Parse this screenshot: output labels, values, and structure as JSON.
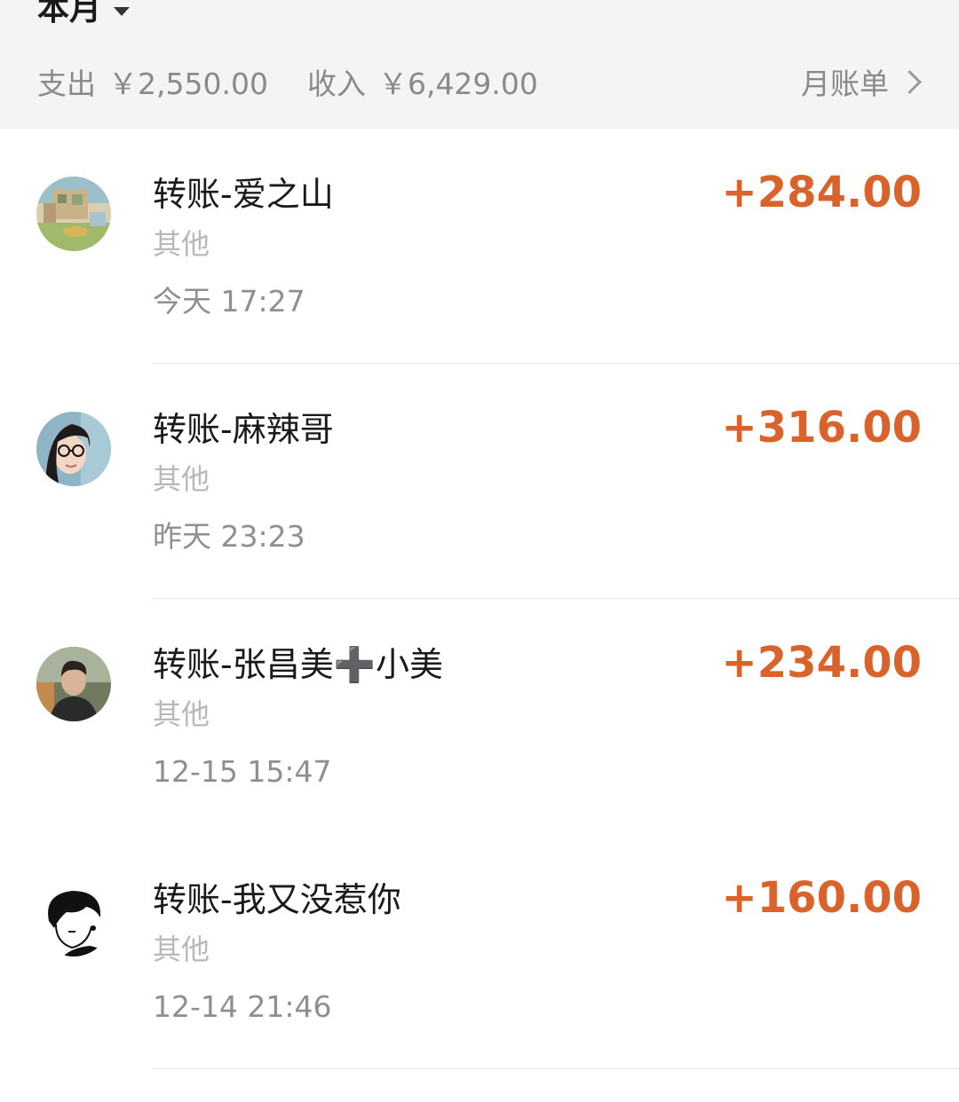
{
  "header": {
    "month_label": "本月",
    "expense_label": "支出",
    "expense_amount": "￥2,550.00",
    "income_label": "收入",
    "income_amount": "￥6,429.00",
    "monthly_bill_label": "月账单"
  },
  "transactions": [
    {
      "title": "转账-爱之山",
      "category": "其他",
      "time": "今天 17:27",
      "amount": "+284.00",
      "avatar": "scenery-illustration-avatar"
    },
    {
      "title": "转账-麻辣哥",
      "category": "其他",
      "time": "昨天 23:23",
      "amount": "+316.00",
      "avatar": "woman-with-glasses-avatar"
    },
    {
      "title": "转账-张昌美➕小美",
      "category": "其他",
      "time": "12-15 15:47",
      "amount": "+234.00",
      "avatar": "man-photo-avatar"
    },
    {
      "title": "转账-我又没惹你",
      "category": "其他",
      "time": "12-14 21:46",
      "amount": "+160.00",
      "avatar": "anime-boy-sketch-avatar"
    }
  ],
  "colors": {
    "income_amount": "#d9632b",
    "header_bg": "#f4f4f4"
  }
}
